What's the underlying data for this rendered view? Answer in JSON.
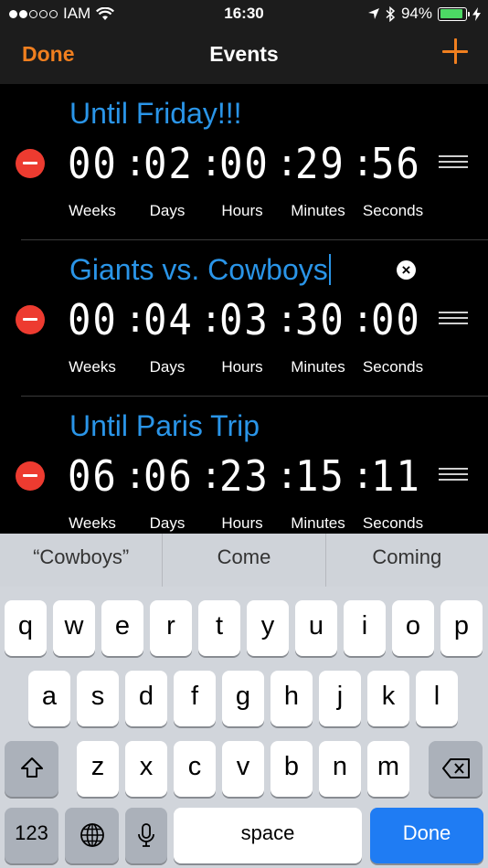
{
  "status_bar": {
    "carrier": "IAM",
    "time": "16:30",
    "battery": "94%",
    "battery_level": 0.94,
    "signal_bars_filled": 2,
    "signal_bars_total": 5
  },
  "nav": {
    "done_label": "Done",
    "title": "Events",
    "add_icon": "plus-icon"
  },
  "events": [
    {
      "name": "Until Friday!!!",
      "weeks": "00",
      "days": "02",
      "hours": "00",
      "minutes": "29",
      "seconds": "56",
      "editing": false
    },
    {
      "name": "Giants vs. Cowboys",
      "weeks": "00",
      "days": "04",
      "hours": "03",
      "minutes": "30",
      "seconds": "00",
      "editing": true
    },
    {
      "name": "Until Paris Trip",
      "weeks": "06",
      "days": "06",
      "hours": "23",
      "minutes": "15",
      "seconds": "11",
      "editing": false
    }
  ],
  "unit_labels": {
    "weeks": "Weeks",
    "days": "Days",
    "hours": "Hours",
    "minutes": "Minutes",
    "seconds": "Seconds"
  },
  "separator": ":",
  "clear_symbol": "×",
  "keyboard": {
    "suggestions": [
      "“Cowboys”",
      "Come",
      "Coming"
    ],
    "row1": [
      "q",
      "w",
      "e",
      "r",
      "t",
      "y",
      "u",
      "i",
      "o",
      "p"
    ],
    "row2": [
      "a",
      "s",
      "d",
      "f",
      "g",
      "h",
      "j",
      "k",
      "l"
    ],
    "row3": [
      "z",
      "x",
      "c",
      "v",
      "b",
      "n",
      "m"
    ],
    "numbers_label": "123",
    "space_label": "space",
    "done_label": "Done",
    "icons": {
      "shift": "shift-icon",
      "delete": "backspace-icon",
      "globe": "globe-icon",
      "mic": "microphone-icon"
    },
    "colors": {
      "done_key": "#1f7cf3",
      "background": "#d1d5db"
    }
  },
  "colors": {
    "accent": "#f07f1f",
    "event_name": "#2a95e8",
    "delete_circle": "#ed3b30"
  }
}
